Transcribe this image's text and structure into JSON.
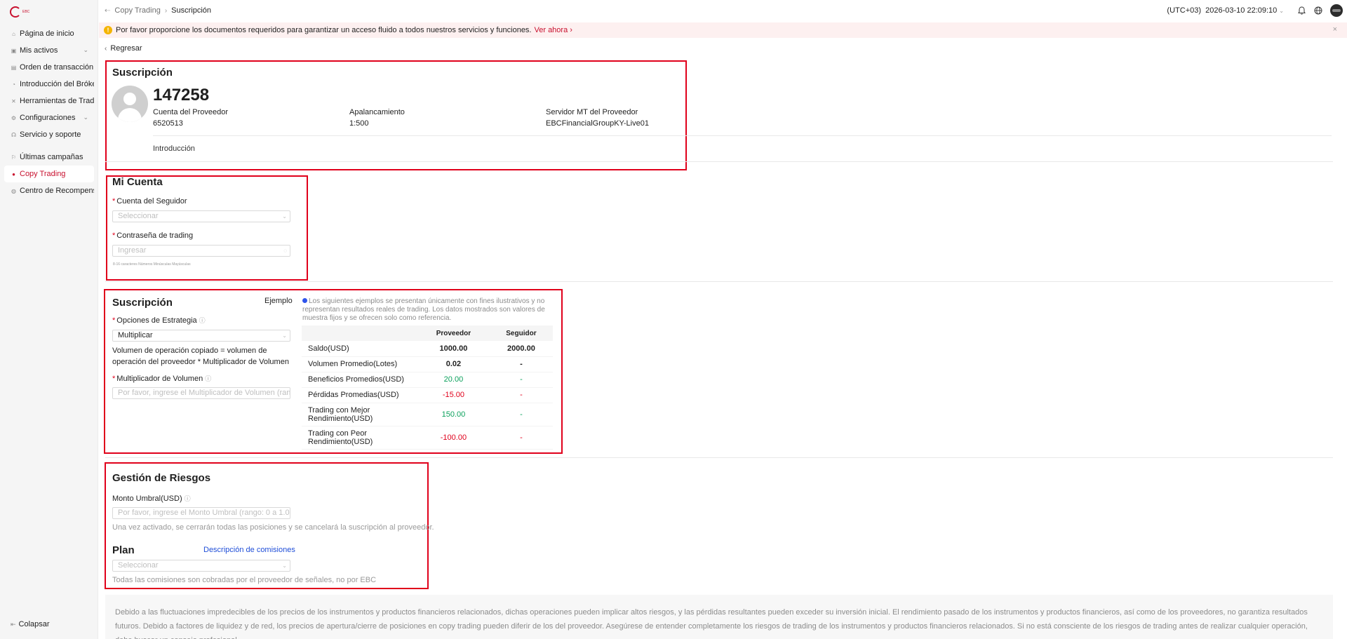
{
  "sidebar": {
    "logo_text": "EBC",
    "items": [
      {
        "label": "Página de inicio",
        "icon": "home-icon"
      },
      {
        "label": "Mis activos",
        "icon": "wallet-icon"
      },
      {
        "label": "Orden de transacción",
        "icon": "order-icon"
      },
      {
        "label": "Introducción del Bróker",
        "icon": "broker-icon"
      },
      {
        "label": "Herramientas de Trading",
        "icon": "tools-icon"
      },
      {
        "label": "Configuraciones",
        "icon": "gear-icon"
      },
      {
        "label": "Servicio y soporte",
        "icon": "support-icon"
      },
      {
        "label": "Últimas campañas",
        "icon": "campaign-icon"
      },
      {
        "label": "Copy Trading",
        "icon": "copy-trading-icon"
      },
      {
        "label": "Centro de Recompensas",
        "icon": "reward-icon"
      }
    ],
    "collapse_label": "Colapsar"
  },
  "header": {
    "breadcrumb_parent": "Copy Trading",
    "breadcrumb_current": "Suscripción",
    "timezone": "(UTC+03)",
    "datetime": "2026-03-10 22:09:10"
  },
  "notice": {
    "text": "Por favor proporcione los documentos requeridos para garantizar un acceso fluido a todos nuestros servicios y funciones.",
    "link": "Ver ahora"
  },
  "back_label": "Regresar",
  "provider": {
    "section_title": "Suscripción",
    "name": "147258",
    "account_label": "Cuenta del Proveedor",
    "account_value": "6520513",
    "leverage_label": "Apalancamiento",
    "leverage_value": "1:500",
    "server_label": "Servidor MT del Proveedor",
    "server_value": "EBCFinancialGroupKY-Live01",
    "intro_label": "Introducción"
  },
  "my_account": {
    "title": "Mi Cuenta",
    "follower_label": "Cuenta del Seguidor",
    "follower_placeholder": "Seleccionar",
    "password_label": "Contraseña de trading",
    "password_placeholder": "Ingresar",
    "password_hint": "8-16 caracteres   Números   Minúsculas   Mayúsculas"
  },
  "subscription": {
    "title": "Suscripción",
    "example_label": "Ejemplo",
    "strategy_label": "Opciones de Estrategia",
    "strategy_value": "Multiplicar",
    "formula": "Volumen de operación copiado = volumen de operación del proveedor * Multiplicador de Volumen",
    "multiplier_label": "Multiplicador de Volumen",
    "multiplier_placeholder": "Por favor, ingrese el Multiplicador de Volumen (rango",
    "example_note": "Los siguientes ejemplos se presentan únicamente con fines ilustrativos y no representan resultados reales de trading. Los datos mostrados son valores de muestra fijos y se ofrecen solo como referencia.",
    "table_headers": [
      "",
      "Proveedor",
      "Seguidor"
    ],
    "rows": [
      {
        "label": "Saldo(USD)",
        "provider": "1000.00",
        "follower": "2000.00"
      },
      {
        "label": "Volumen Promedio(Lotes)",
        "provider": "0.02",
        "follower": "-"
      },
      {
        "label": "Beneficios Promedios(USD)",
        "provider": "20.00",
        "follower": "-"
      },
      {
        "label": "Pérdidas Promedias(USD)",
        "provider": "-15.00",
        "follower": "-"
      },
      {
        "label": "Trading con Mejor Rendimiento(USD)",
        "provider": "150.00",
        "follower": "-"
      },
      {
        "label": "Trading con Peor Rendimiento(USD)",
        "provider": "-100.00",
        "follower": "-"
      }
    ]
  },
  "risk": {
    "title": "Gestión de Riesgos",
    "threshold_label": "Monto Umbral(USD)",
    "threshold_placeholder": "Por favor, ingrese el Monto Umbral (rango: 0 a 1.00",
    "threshold_help": "Una vez activado, se cerrarán todas las posiciones y se cancelará la suscripción al proveedor.",
    "plan_title": "Plan",
    "fee_link": "Descripción de comisiones",
    "plan_placeholder": "Seleccionar",
    "plan_help": "Todas las comisiones son cobradas por el proveedor de señales, no por EBC"
  },
  "disclaimer": "Debido a las fluctuaciones impredecibles de los precios de los instrumentos y productos financieros relacionados, dichas operaciones pueden implicar altos riesgos, y las pérdidas resultantes pueden exceder su inversión inicial. El rendimiento pasado de los instrumentos y productos financieros, así como de los proveedores, no garantiza resultados futuros. Debido a factores de liquidez y de red, los precios de apertura/cierre de posiciones en copy trading pueden diferir de los del proveedor. Asegúrese de entender completamente los riesgos de trading de los instrumentos y productos financieros relacionados. Si no está consciente de los riesgos de trading antes de realizar cualquier operación, debe buscar un consejo profesional.",
  "colors": {
    "accent": "#c8102e",
    "highlight": "#e0001b",
    "positive": "#0aa05b",
    "link": "#1f4ed8"
  }
}
